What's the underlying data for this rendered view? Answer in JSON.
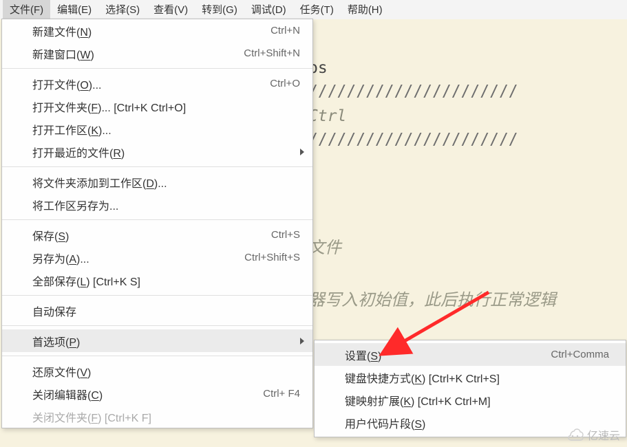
{
  "menubar": {
    "items": [
      {
        "label": "文件(F)"
      },
      {
        "label": "编辑(E)"
      },
      {
        "label": "选择(S)"
      },
      {
        "label": "查看(V)"
      },
      {
        "label": "转到(G)"
      },
      {
        "label": "调试(D)"
      },
      {
        "label": "任务(T)"
      },
      {
        "label": "帮助(H)"
      }
    ]
  },
  "file_menu": {
    "new_file": {
      "label_pre": "新建文件(",
      "hotkey": "N",
      "label_post": ")",
      "shortcut": "Ctrl+N"
    },
    "new_window": {
      "label_pre": "新建窗口(",
      "hotkey": "W",
      "label_post": ")",
      "shortcut": "Ctrl+Shift+N"
    },
    "open_file": {
      "label_pre": "打开文件(",
      "hotkey": "O",
      "label_post": ")...",
      "shortcut": "Ctrl+O"
    },
    "open_folder": {
      "label_pre": "打开文件夹(",
      "hotkey": "F",
      "label_post": ")... [Ctrl+K Ctrl+O]",
      "shortcut": ""
    },
    "open_workspace": {
      "label_pre": "打开工作区(",
      "hotkey": "K",
      "label_post": ")...",
      "shortcut": ""
    },
    "open_recent": {
      "label_pre": "打开最近的文件(",
      "hotkey": "R",
      "label_post": ")",
      "shortcut": ""
    },
    "add_folder": {
      "label_pre": "将文件夹添加到工作区(",
      "hotkey": "D",
      "label_post": ")...",
      "shortcut": ""
    },
    "save_workspace_as": {
      "label_pre": "将工作区另存为...",
      "hotkey": "",
      "label_post": "",
      "shortcut": ""
    },
    "save": {
      "label_pre": "保存(",
      "hotkey": "S",
      "label_post": ")",
      "shortcut": "Ctrl+S"
    },
    "save_as": {
      "label_pre": "另存为(",
      "hotkey": "A",
      "label_post": ")...",
      "shortcut": "Ctrl+Shift+S"
    },
    "save_all": {
      "label_pre": "全部保存(",
      "hotkey": "L",
      "label_post": ") [Ctrl+K S]",
      "shortcut": ""
    },
    "auto_save": {
      "label_pre": "自动保存",
      "hotkey": "",
      "label_post": "",
      "shortcut": ""
    },
    "preferences": {
      "label_pre": "首选项(",
      "hotkey": "P",
      "label_post": ")",
      "shortcut": ""
    },
    "revert_file": {
      "label_pre": "还原文件(",
      "hotkey": "V",
      "label_post": ")",
      "shortcut": ""
    },
    "close_editor": {
      "label_pre": "关闭编辑器(",
      "hotkey": "C",
      "label_post": ")",
      "shortcut": "Ctrl+  F4"
    },
    "close_folder": {
      "label_pre": "关闭文件夹(",
      "hotkey": "F",
      "label_post": ") [Ctrl+K F]",
      "shortcut": ""
    }
  },
  "pref_submenu": {
    "settings": {
      "label_pre": "设置(",
      "hotkey": "S",
      "label_post": ")",
      "shortcut": "Ctrl+Comma"
    },
    "keyboard_shortcuts": {
      "label_pre": "键盘快捷方式(",
      "hotkey": "K",
      "label_post": ") [Ctrl+K Ctrl+S]",
      "shortcut": ""
    },
    "keymap_ext": {
      "label_pre": "键映射扩展(",
      "hotkey": "K",
      "label_post": ") [Ctrl+K Ctrl+M]",
      "shortcut": ""
    },
    "user_snippets": {
      "label_pre": "用户代码片段(",
      "hotkey": "S",
      "label_post": ")",
      "shortcut": ""
    }
  },
  "editor_bg": {
    "line1": "ps",
    "line2": "//////////////////////",
    "line3": "Ctrl",
    "line4": "//////////////////////",
    "line5": "文件",
    "line6": "器写入初始值，此后执行正常逻辑"
  },
  "watermark": {
    "text": "亿速云"
  }
}
